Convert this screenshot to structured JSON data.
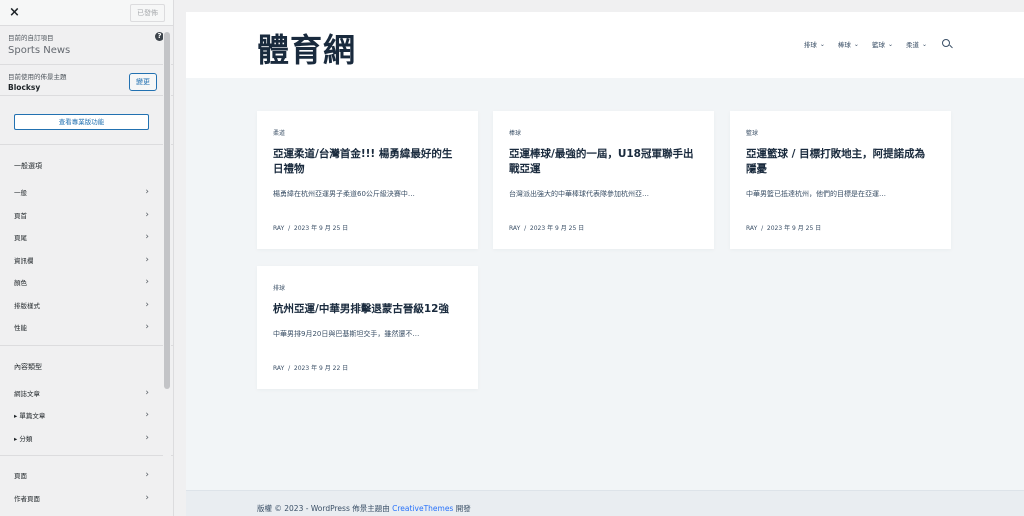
{
  "sidebar": {
    "close": "×",
    "publish_label": "已發佈",
    "customizing_label": "目前的自訂項目",
    "site_name": "Sports News",
    "help": "?",
    "active_theme_label": "目前使用的佈景主題",
    "theme_name": "Blocksy",
    "change_label": "變更",
    "pro_button": "查看專業版功能",
    "section_general": "一般選項",
    "general_items": [
      "一般",
      "頁首",
      "頁尾",
      "資訊欄",
      "顏色",
      "排版樣式",
      "性能"
    ],
    "section_content": "內容類型",
    "content_items": [
      "網誌文章",
      "▸ 單篇文章",
      "▸ 分類"
    ],
    "page_items": [
      "頁面",
      "作者頁面"
    ]
  },
  "preview": {
    "logo": "體育網",
    "nav": [
      "排球",
      "棒球",
      "籃球",
      "柔道"
    ],
    "posts": [
      {
        "category": "柔道",
        "title": "亞運柔道/台灣首金!!! 楊勇緯最好的生日禮物",
        "excerpt": "楊勇緯在杭州亞運男子柔道60公斤級決賽中…",
        "author": "RAY",
        "date": "2023 年 9 月 25 日"
      },
      {
        "category": "棒球",
        "title": "亞運棒球/最強的一屆，U18冠軍聯手出戰亞運",
        "excerpt": "台灣派出強大的中華棒球代表隊參加杭州亞…",
        "author": "RAY",
        "date": "2023 年 9 月 25 日"
      },
      {
        "category": "籃球",
        "title": "亞運籃球 / 目標打敗地主，阿提諾成為隱憂",
        "excerpt": "中華男籃已抵達杭州，他們的目標是在亞運…",
        "author": "RAY",
        "date": "2023 年 9 月 25 日"
      },
      {
        "category": "排球",
        "title": "杭州亞運/中華男排擊退蒙古晉級12強",
        "excerpt": "中華男排9月20日與巴基斯坦交手，雖然還不…",
        "author": "RAY",
        "date": "2023 年 9 月 22 日"
      }
    ],
    "meta_sep": "/",
    "footer_prefix": "版權 © 2023 - WordPress 佈景主題由 ",
    "footer_link": "CreativeThemes",
    "footer_suffix": " 開發"
  },
  "colors": {
    "accent": "#2271b1",
    "heading": "#192a3d",
    "link": "#2872fa"
  }
}
